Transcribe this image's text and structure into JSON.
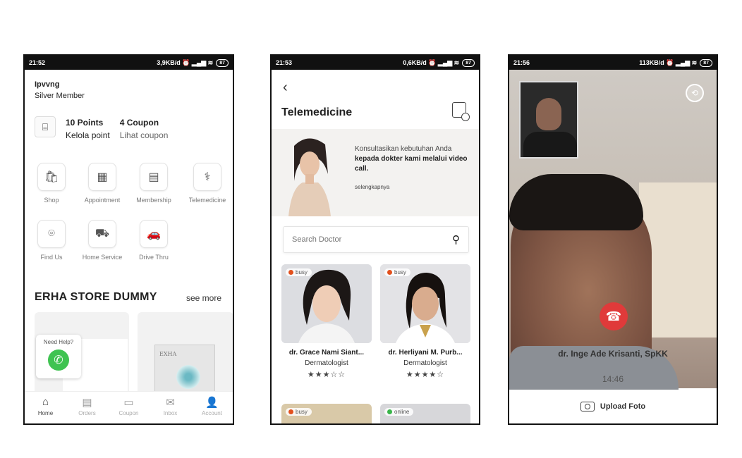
{
  "screen1": {
    "status": {
      "time": "21:52",
      "info": "3,9KB/d ⏰ ▂▄▆ ≋",
      "battery": "87"
    },
    "user": {
      "name": "Ipvvng",
      "tier": "Silver Member"
    },
    "points": {
      "value": "10 Points",
      "sub": "Kelola point"
    },
    "coupon": {
      "value": "4 Coupon",
      "sub": "Lihat coupon"
    },
    "menu": [
      {
        "label": "Shop",
        "icon": "shopping-bag-icon"
      },
      {
        "label": "Appointment",
        "icon": "calendar-icon"
      },
      {
        "label": "Membership",
        "icon": "membership-card-icon"
      },
      {
        "label": "Telemedicine",
        "icon": "telemedicine-icon"
      },
      {
        "label": "Find Us",
        "icon": "location-pin-icon"
      },
      {
        "label": "Home Service",
        "icon": "delivery-truck-icon"
      },
      {
        "label": "Drive Thru",
        "icon": "drive-thru-icon"
      }
    ],
    "store_title": "ERHA STORE DUMMY",
    "see_more": "see more",
    "help_label": "Need Help?",
    "product_brand": "EXHA",
    "nav": [
      {
        "label": "Home",
        "icon": "home-icon"
      },
      {
        "label": "Orders",
        "icon": "orders-icon"
      },
      {
        "label": "Coupon",
        "icon": "coupon-icon"
      },
      {
        "label": "Inbox",
        "icon": "inbox-icon"
      },
      {
        "label": "Account",
        "icon": "account-icon"
      }
    ]
  },
  "screen2": {
    "status": {
      "time": "21:53",
      "info": "0,6KB/d ⏰ ▂▄▆ ≋",
      "battery": "87"
    },
    "title": "Telemedicine",
    "banner": {
      "line1": "Konsultasikan kebutuhan Anda",
      "line2": "kepada dokter kami melalui video call.",
      "more": "selengkapnya"
    },
    "search_placeholder": "Search Doctor",
    "doctors": [
      {
        "name": "dr. Grace Nami Siant...",
        "specialty": "Dermatologist",
        "status": "busy",
        "stars": "★★★☆☆"
      },
      {
        "name": "dr. Herliyani M. Purb...",
        "specialty": "Dermatologist",
        "status": "busy",
        "stars": "★★★★☆"
      }
    ],
    "doctors_row2": [
      {
        "status": "busy"
      },
      {
        "status": "online"
      }
    ]
  },
  "screen3": {
    "status": {
      "time": "21:56",
      "info": "113KB/d ⏰ ▂▄▆ ≋",
      "battery": "87"
    },
    "doctor_name": "dr. Inge Ade Krisanti, SpKK",
    "call_time": "14:46",
    "upload_label": "Upload Foto"
  },
  "colors": {
    "busy": "#e2501d",
    "online": "#39b54a",
    "hangup": "#e03a3a",
    "whatsapp": "#3fc351"
  }
}
